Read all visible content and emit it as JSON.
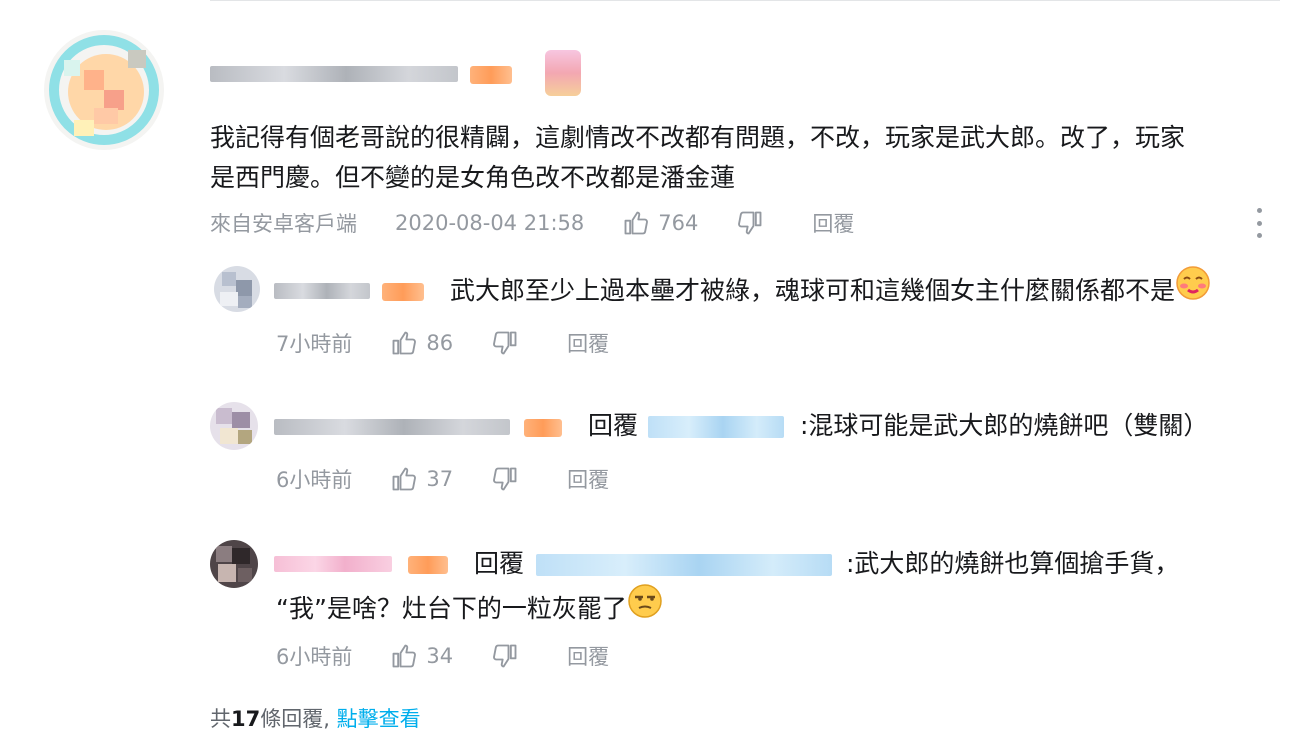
{
  "comment": {
    "text_line1": "我記得有個老哥說的很精闢，這劇情改不改都有問題，不改，玩家是武大郎。改了，玩家",
    "text_line2": "是西門慶。但不變的是女角色改不改都是潘金蓮",
    "source": "來自安卓客戶端",
    "time": "2020-08-04 21:58",
    "likes": "764",
    "reply_label": "回覆"
  },
  "replies": [
    {
      "text": "武大郎至少上過本壘才被綠，魂球可和這幾個女主什麼關係都不是",
      "time": "7小時前",
      "likes": "86",
      "reply_label": "回覆",
      "emoji": "blush-face-icon"
    },
    {
      "prefix": "回覆",
      "text": ":混球可能是武大郎的燒餅吧（雙關）",
      "time": "6小時前",
      "likes": "37",
      "reply_label": "回覆"
    },
    {
      "prefix": "回覆",
      "text_line1": ":武大郎的燒餅也算個搶手貨，",
      "text_line2": "“我”是啥？灶台下的一粒灰罷了",
      "time": "6小時前",
      "likes": "34",
      "reply_label": "回覆",
      "emoji": "smirk-face-icon"
    }
  ],
  "footer": {
    "prefix": "共",
    "count": "17",
    "suffix": "條回覆,",
    "link": "點擊查看"
  },
  "colors": {
    "text": "#18191c",
    "meta": "#9499a0",
    "link": "#00aeec",
    "level_badge": "#ff9c59"
  }
}
